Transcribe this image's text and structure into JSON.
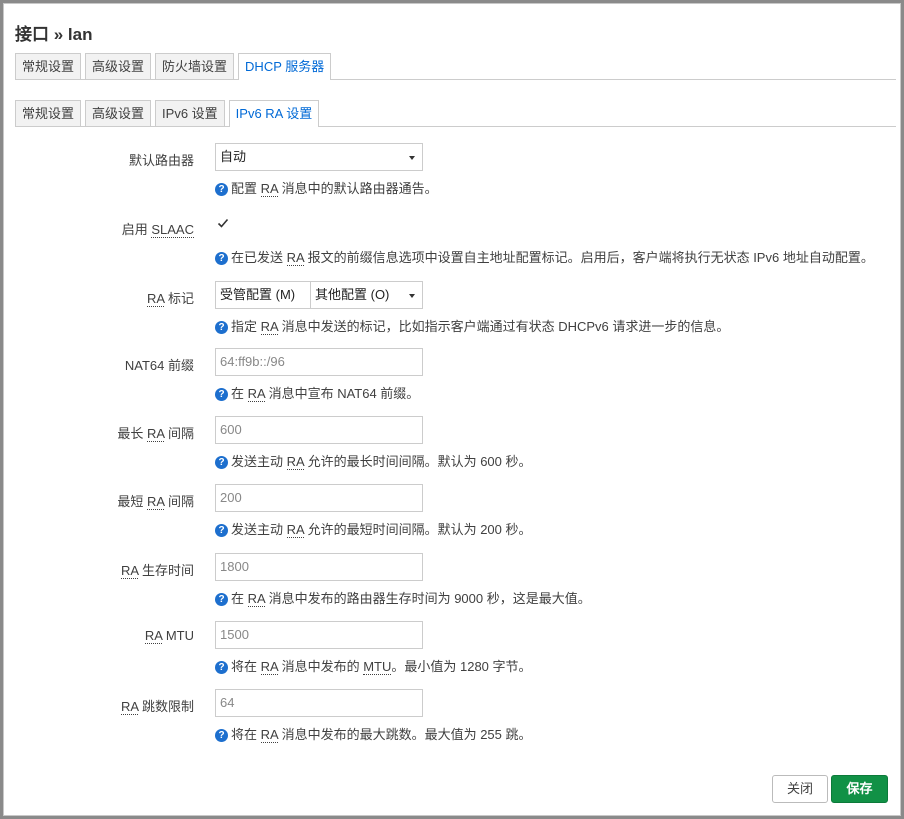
{
  "dialog": {
    "title": "接口 » lan"
  },
  "main_tabs": [
    "常规设置",
    "高级设置",
    "防火墙设置",
    "DHCP 服务器"
  ],
  "sub_tabs": [
    "常规设置",
    "高级设置",
    "IPv6 设置",
    "IPv6 RA 设置"
  ],
  "fields": {
    "default_router": {
      "label": "默认路由器",
      "value": "自动",
      "help_pre": "配置 ",
      "help_abbr": "RA",
      "help_post": " 消息中的默认路由器通告。"
    },
    "slaac": {
      "label_pre": "启用 ",
      "label_abbr": "SLAAC",
      "checked": true,
      "help_pre": "在已发送 ",
      "help_abbr": "RA",
      "help_post": " 报文的前缀信息选项中设置自主地址配置标记。启用后，客户端将执行无状态 IPv6 地址自动配置。"
    },
    "ra_flags": {
      "label_abbr": "RA",
      "label_post": " 标记",
      "chip1": "受管配置 (M)",
      "chip2": "其他配置 (O)",
      "help_pre": "指定 ",
      "help_abbr": "RA",
      "help_post": " 消息中发送的标记，比如指示客户端通过有状态 DHCPv6 请求进一步的信息。"
    },
    "nat64": {
      "label": "NAT64 前缀",
      "placeholder": "64:ff9b::/96",
      "help_pre": "在 ",
      "help_abbr": "RA",
      "help_post": " 消息中宣布 NAT64 前缀。"
    },
    "max_interval": {
      "label_pre": "最长 ",
      "label_abbr": "RA",
      "label_post": " 间隔",
      "placeholder": "600",
      "help_pre": "发送主动 ",
      "help_abbr": "RA",
      "help_post": " 允许的最长时间间隔。默认为 600 秒。"
    },
    "min_interval": {
      "label_pre": "最短 ",
      "label_abbr": "RA",
      "label_post": " 间隔",
      "placeholder": "200",
      "help_pre": "发送主动 ",
      "help_abbr": "RA",
      "help_post": " 允许的最短时间间隔。默认为 200 秒。"
    },
    "lifetime": {
      "label_abbr": "RA",
      "label_post": " 生存时间",
      "placeholder": "1800",
      "help_pre": "在 ",
      "help_abbr": "RA",
      "help_post": " 消息中发布的路由器生存时间为 9000 秒，这是最大值。"
    },
    "mtu": {
      "label_abbr": "RA",
      "label_post": " MTU",
      "placeholder": "1500",
      "help_pre": "将在 ",
      "help_abbr": "RA",
      "help_mid": " 消息中发布的 ",
      "help_abbr2": "MTU",
      "help_post": "。最小值为 1280 字节。"
    },
    "hoplimit": {
      "label_abbr": "RA",
      "label_post": " 跳数限制",
      "placeholder": "64",
      "help_pre": "将在 ",
      "help_abbr": "RA",
      "help_post": " 消息中发布的最大跳数。最大值为 255 跳。"
    }
  },
  "buttons": {
    "close": "关闭",
    "save": "保存"
  },
  "colors": {
    "accent": "#0069d6",
    "save": "#119146",
    "help_icon": "#1d6fce"
  },
  "icons": {
    "help": "?"
  }
}
